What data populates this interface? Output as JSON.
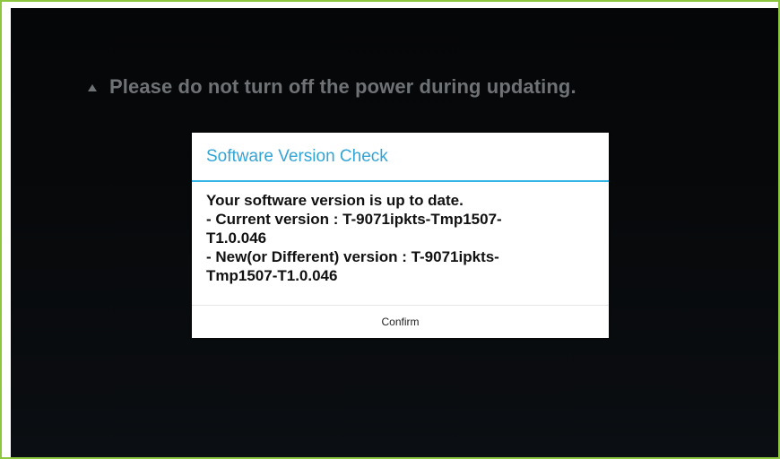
{
  "screen": {
    "warning_text": "Please do not turn off the power during updating."
  },
  "dialog": {
    "title": "Software Version Check",
    "body_lines": [
      "Your software version is up to date.",
      "- Current version : T-9071ipkts-Tmp1507-",
      "T1.0.046",
      "- New(or Different) version : T-9071ipkts-",
      "Tmp1507-T1.0.046"
    ],
    "confirm_label": "Confirm"
  },
  "colors": {
    "frame_border": "#8dc63f",
    "title_accent": "#33a4d6",
    "warning_text": "#6f7275"
  }
}
